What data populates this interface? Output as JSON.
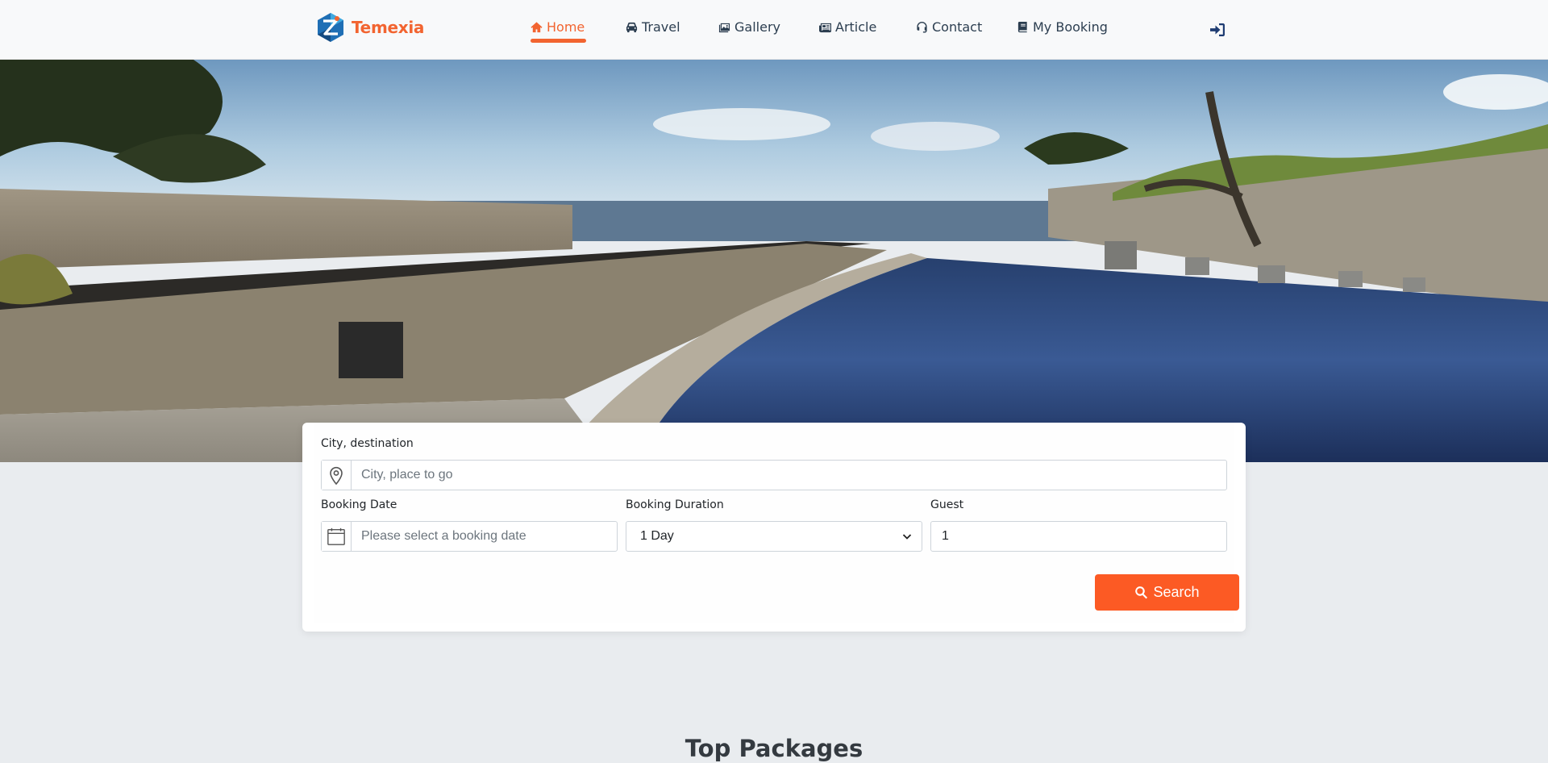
{
  "brand": {
    "name": "Temexia"
  },
  "nav": {
    "items": [
      {
        "label": "Home",
        "icon": "home-icon",
        "active": true
      },
      {
        "label": "Travel",
        "icon": "car-icon",
        "active": false
      },
      {
        "label": "Gallery",
        "icon": "images-icon",
        "active": false
      },
      {
        "label": "Article",
        "icon": "newspaper-icon",
        "active": false
      },
      {
        "label": "Contact",
        "icon": "headset-icon",
        "active": false
      },
      {
        "label": "My Booking",
        "icon": "book-icon",
        "active": false
      }
    ],
    "login_icon": "sign-in-icon"
  },
  "search": {
    "destination_label": "City, destination",
    "destination_placeholder": "City, place to go",
    "date_label": "Booking Date",
    "date_placeholder": "Please select a booking date",
    "duration_label": "Booking Duration",
    "duration_value": "1 Day",
    "guest_label": "Guest",
    "guest_value": "1",
    "button_label": "Search"
  },
  "sections": {
    "top_packages_title": "Top Packages"
  },
  "colors": {
    "accent": "#f26430",
    "button": "#fc5a24",
    "nav_text": "#2c3e50",
    "page_bg": "#e9ecef"
  }
}
